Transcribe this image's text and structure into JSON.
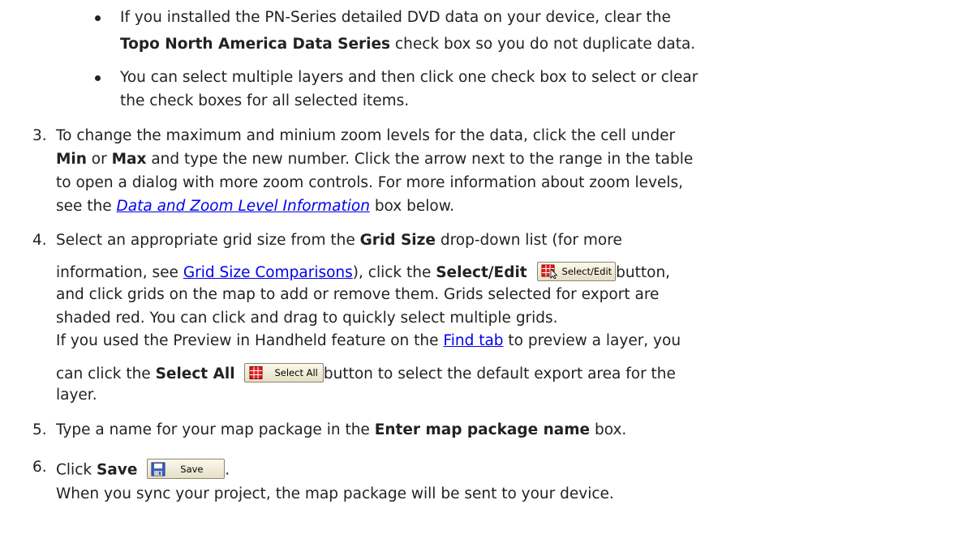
{
  "bullets": {
    "b1_line1": "If you installed the PN-Series detailed DVD data on your device, clear the",
    "b1_bold": "Topo North America Data Series",
    "b1_line2_rest": " check box so you do not duplicate data.",
    "b2_line1": "You can select multiple layers and then click one check box to select or clear",
    "b2_line2": "the check boxes for all selected items."
  },
  "step3": {
    "num": "3.",
    "l1": "To change the maximum and minium zoom levels for the data, click the cell under",
    "bold_min": "Min",
    "or": " or ",
    "bold_max": "Max",
    "l2_rest": " and type the new number. Click the arrow next to the range in the table",
    "l3": "to open a dialog with more zoom controls. For more information about zoom levels,",
    "l4_pre": "see the ",
    "l4_link": "Data and Zoom Level Information",
    "l4_post": " box below."
  },
  "step4": {
    "num": "4.",
    "l1_pre": "Select an appropriate grid size from the ",
    "l1_bold": "Grid Size",
    "l1_post": " drop-down list (for more",
    "l2_pre": "information, see ",
    "l2_link": "Grid Size Comparisons",
    "l2_mid": "), click the ",
    "l2_bold": "Select/Edit",
    "select_edit_label": "Select/Edit",
    "l2_post": "button,",
    "l3": "and click grids on the map to add or remove them. Grids selected for export are",
    "l4": "shaded red. You can click and drag to quickly select multiple grids.",
    "l5_pre": "If you used the Preview in Handheld feature on the ",
    "l5_link": "Find tab",
    "l5_post": " to preview a layer, you",
    "l6_pre": "can click the ",
    "l6_bold": "Select All",
    "select_all_label": "Select All",
    "l6_post": "button to select the default export area for the",
    "l7": "layer."
  },
  "step5": {
    "num": "5.",
    "pre": "Type a name for your map package in the ",
    "bold": "Enter map package name",
    "post": " box."
  },
  "step6": {
    "num": "6.",
    "pre": "Click ",
    "bold": "Save",
    "save_label": "Save",
    "post": ".",
    "l2": "When you sync your project, the map package will be sent to your device."
  },
  "colors": {
    "link": "#0000ee",
    "text": "#222222",
    "grid_icon": "#d40000"
  },
  "icons": [
    "grid-select-icon",
    "grid-select-all-icon",
    "floppy-disk-icon"
  ]
}
